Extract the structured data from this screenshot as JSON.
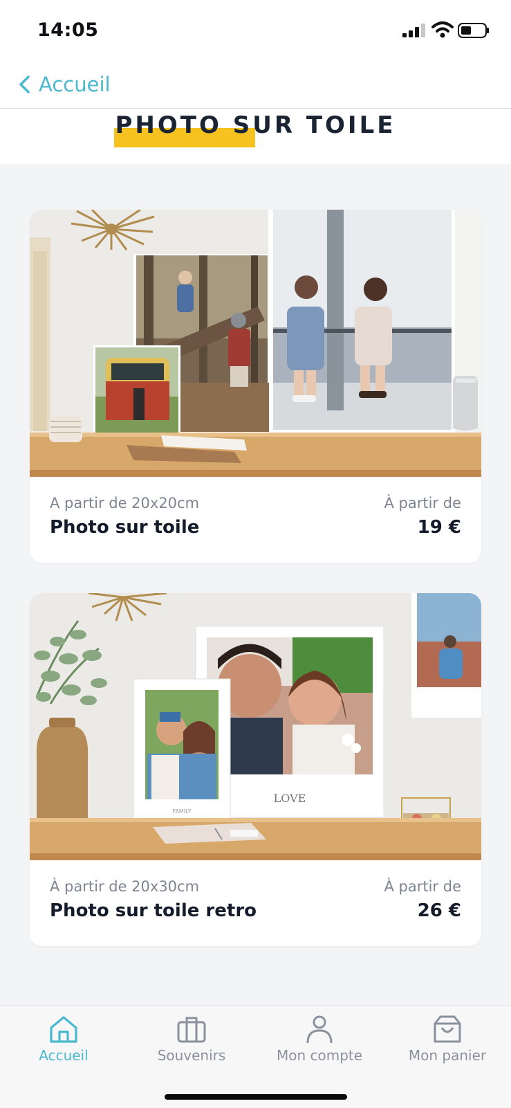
{
  "status_bar": {
    "time": "14:05"
  },
  "nav": {
    "back_label": "Accueil"
  },
  "page": {
    "title": "PHOTO SUR TOILE"
  },
  "products": [
    {
      "subtitle": "A partir de 20x20cm",
      "name": "Photo sur toile",
      "price_prefix": "À partir de",
      "price": "19 €"
    },
    {
      "subtitle": "À partir de 20x30cm",
      "name": "Photo sur toile retro",
      "price_prefix": "À partir de",
      "price": "26 €",
      "image_labels": {
        "love": "LOVE",
        "family": "FAMILY"
      }
    }
  ],
  "tab_bar": {
    "tabs": [
      {
        "label": "Accueil",
        "icon": "home-icon",
        "active": true
      },
      {
        "label": "Souvenirs",
        "icon": "briefcase-icon",
        "active": false
      },
      {
        "label": "Mon compte",
        "icon": "user-icon",
        "active": false
      },
      {
        "label": "Mon panier",
        "icon": "bag-icon",
        "active": false
      }
    ]
  },
  "colors": {
    "accent": "#4ab8cf",
    "highlight": "#f6c220",
    "text_dark": "#141b2a",
    "text_muted": "#7d8592"
  }
}
